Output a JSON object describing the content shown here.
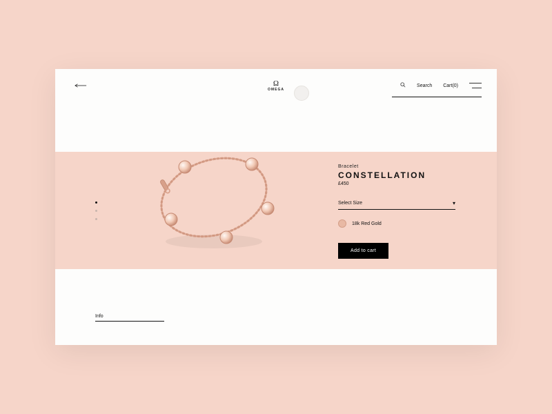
{
  "brand": {
    "glyph": "Ω",
    "name": "OMEGA"
  },
  "header": {
    "search_label": "Search",
    "cart_label": "Cart(0)"
  },
  "pagination": {
    "active": 0,
    "count": 3
  },
  "product": {
    "category": "Bracelet",
    "name": "CONSTELLATION",
    "price": "£450",
    "size_placeholder": "Select Size",
    "material_label": "18k Red Gold",
    "add_label": "Add to cart"
  },
  "footer": {
    "info_label": "Info"
  },
  "colors": {
    "bg": "#f6d5c9",
    "gold": "#d8a08a",
    "gold_dark": "#c68a73"
  }
}
